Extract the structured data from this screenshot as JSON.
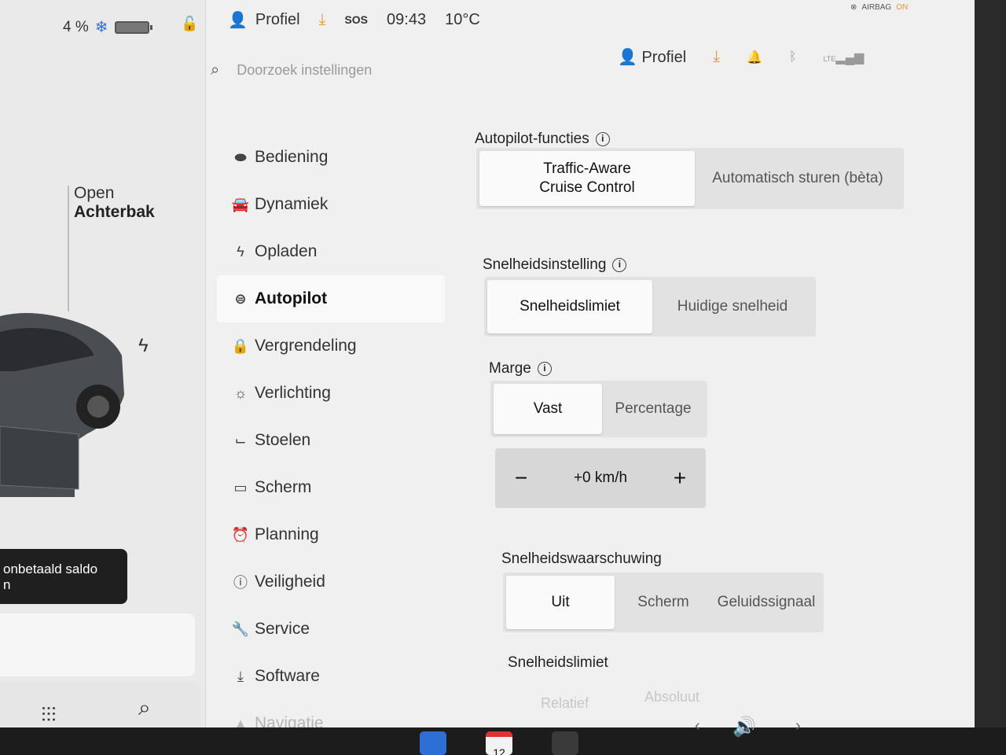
{
  "status": {
    "battery_percent": "4 %",
    "profile": "Profiel",
    "sos": "SOS",
    "time": "09:43",
    "temperature": "10°C",
    "airbag": "AIRBAG",
    "airbag_state": "ON"
  },
  "car": {
    "trunk_action": "Open",
    "trunk_name": "Achterbak",
    "toast": "onbetaald saldo",
    "toast_sub": "n"
  },
  "header": {
    "search_placeholder": "Doorzoek instellingen",
    "profile": "Profiel",
    "signal": "LTE"
  },
  "nav": {
    "items": [
      {
        "label": "Bediening",
        "icon": "toggle-icon"
      },
      {
        "label": "Dynamiek",
        "icon": "car-icon"
      },
      {
        "label": "Opladen",
        "icon": "bolt-icon"
      },
      {
        "label": "Autopilot",
        "icon": "steering-wheel-icon"
      },
      {
        "label": "Vergrendeling",
        "icon": "lock-icon"
      },
      {
        "label": "Verlichting",
        "icon": "light-icon"
      },
      {
        "label": "Stoelen",
        "icon": "seat-icon"
      },
      {
        "label": "Scherm",
        "icon": "display-icon"
      },
      {
        "label": "Planning",
        "icon": "alarm-icon"
      },
      {
        "label": "Veiligheid",
        "icon": "alert-icon"
      },
      {
        "label": "Service",
        "icon": "wrench-icon"
      },
      {
        "label": "Software",
        "icon": "download-icon"
      },
      {
        "label": "Navigatie",
        "icon": "navigation-icon"
      }
    ]
  },
  "content": {
    "autopilot_functions": {
      "title": "Autopilot-functies",
      "options": [
        "Traffic-Aware\nCruise Control",
        "Automatisch sturen (bèta)"
      ]
    },
    "speed_setting": {
      "title": "Snelheidsinstelling",
      "options": [
        "Snelheidslimiet",
        "Huidige snelheid"
      ]
    },
    "margin": {
      "title": "Marge",
      "options": [
        "Vast",
        "Percentage"
      ],
      "value": "+0 km/h",
      "minus": "−",
      "plus": "+"
    },
    "speed_warning": {
      "title": "Snelheidswaarschuwing",
      "options": [
        "Uit",
        "Scherm",
        "Geluidssignaal"
      ]
    },
    "speed_limit": {
      "title": "Snelheidslimiet",
      "options": [
        "Relatief",
        "Absoluut"
      ]
    }
  },
  "taskbar": {
    "calendar_day": "12"
  }
}
